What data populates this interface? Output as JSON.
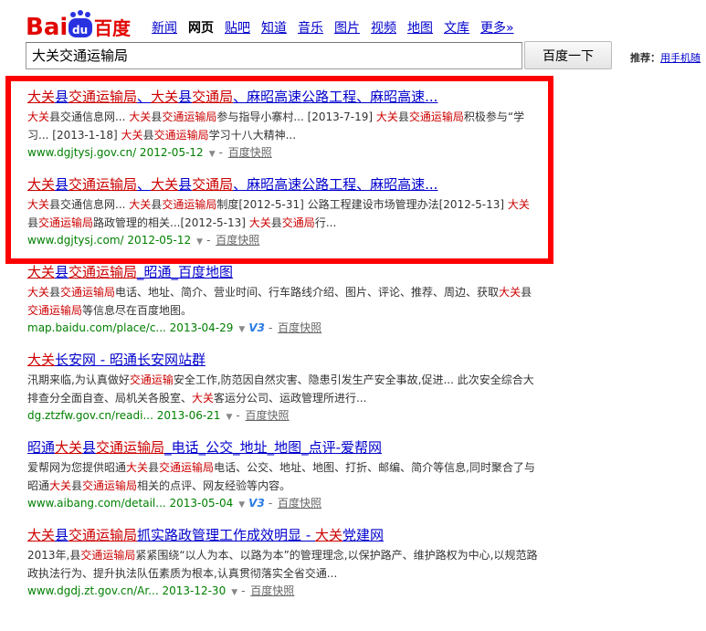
{
  "logo": {
    "text_bai": "Bai",
    "text_du": "du",
    "text_cn": "百度"
  },
  "nav": [
    "新闻",
    "网页",
    "贴吧",
    "知道",
    "音乐",
    "图片",
    "视频",
    "地图",
    "文库",
    "更多»"
  ],
  "nav_active": 1,
  "search": {
    "query": "大关交通运输局",
    "button": "百度一下"
  },
  "recommend": {
    "label": "推荐：",
    "link": "用手机随"
  },
  "results": [
    {
      "title": [
        [
          "大关",
          "h"
        ],
        [
          "县",
          "n"
        ],
        [
          "交通运输局",
          "h"
        ],
        [
          "、",
          "n"
        ],
        [
          "大关",
          "h"
        ],
        [
          "县",
          "n"
        ],
        [
          "交通局",
          "h"
        ],
        [
          "、麻昭高速公路工程、麻昭高速...",
          "n"
        ]
      ],
      "abstract": [
        [
          "大关",
          "h"
        ],
        [
          "县交通信息网... ",
          "n"
        ],
        [
          "大关",
          "h"
        ],
        [
          "县",
          "n"
        ],
        [
          "交通运输局",
          "h"
        ],
        [
          "参与指导小寨村... [2013-7-19] ",
          "n"
        ],
        [
          "大关",
          "h"
        ],
        [
          "县",
          "n"
        ],
        [
          "交通运输局",
          "h"
        ],
        [
          "积极参与“学习... [2013-1-18] ",
          "n"
        ],
        [
          "大关",
          "h"
        ],
        [
          "县",
          "n"
        ],
        [
          "交通运输局",
          "h"
        ],
        [
          "学习十八大精神...",
          "n"
        ]
      ],
      "url": "www.dgjtysj.gov.cn/ 2012-05-12",
      "v3": false,
      "snapshot": "百度快照"
    },
    {
      "title": [
        [
          "大关",
          "h"
        ],
        [
          "县",
          "n"
        ],
        [
          "交通运输局",
          "h"
        ],
        [
          "、",
          "n"
        ],
        [
          "大关",
          "h"
        ],
        [
          "县",
          "n"
        ],
        [
          "交通局",
          "h"
        ],
        [
          "、麻昭高速公路工程、麻昭高速...",
          "n"
        ]
      ],
      "abstract": [
        [
          "大关",
          "h"
        ],
        [
          "县交通信息网... ",
          "n"
        ],
        [
          "大关",
          "h"
        ],
        [
          "县",
          "n"
        ],
        [
          "交通运输局",
          "h"
        ],
        [
          "制度[2012-5-31] 公路工程建设市场管理办法[2012-5-13] ",
          "n"
        ],
        [
          "大关",
          "h"
        ],
        [
          "县",
          "n"
        ],
        [
          "交通运输局",
          "h"
        ],
        [
          "路政管理的相关...[2012-5-13] ",
          "n"
        ],
        [
          "大关",
          "h"
        ],
        [
          "县",
          "n"
        ],
        [
          "交通局",
          "h"
        ],
        [
          "行...",
          "n"
        ]
      ],
      "url": "www.dgjtysj.com/ 2012-05-12",
      "v3": false,
      "snapshot": "百度快照"
    },
    {
      "title": [
        [
          "大关",
          "h"
        ],
        [
          "县",
          "n"
        ],
        [
          "交通运输局",
          "h"
        ],
        [
          "_昭通_百度地图",
          "n"
        ]
      ],
      "abstract": [
        [
          "大关",
          "h"
        ],
        [
          "县",
          "n"
        ],
        [
          "交通运输局",
          "h"
        ],
        [
          "电话、地址、简介、营业时间、行车路线介绍、图片、评论、推荐、周边、获取",
          "n"
        ],
        [
          "大关",
          "h"
        ],
        [
          "县",
          "n"
        ],
        [
          "交通运输局",
          "h"
        ],
        [
          "等信息尽在百度地图。",
          "n"
        ]
      ],
      "url": "map.baidu.com/place/c... 2013-04-29",
      "v3": true,
      "snapshot": "百度快照"
    },
    {
      "title": [
        [
          "大关",
          "h"
        ],
        [
          "长安网 - 昭通长安网站群",
          "n"
        ]
      ],
      "abstract": [
        [
          "汛期来临,为认真做好",
          "n"
        ],
        [
          "交通运输",
          "h"
        ],
        [
          "安全工作,防范因自然灾害、隐患引发生产安全事故,促进... 此次安全综合大排查分全面自查、局机关各股室、",
          "n"
        ],
        [
          "大关",
          "h"
        ],
        [
          "客运分公司、运政管理所进行...",
          "n"
        ]
      ],
      "url": "dg.ztzfw.gov.cn/readi... 2013-06-21",
      "v3": false,
      "snapshot": "百度快照"
    },
    {
      "title": [
        [
          "昭通",
          "n"
        ],
        [
          "大关",
          "h"
        ],
        [
          "县",
          "n"
        ],
        [
          "交通运输局",
          "h"
        ],
        [
          "_电话_公交_地址_地图_点评-爱帮网",
          "n"
        ]
      ],
      "abstract": [
        [
          "爱帮网为您提供昭通",
          "n"
        ],
        [
          "大关",
          "h"
        ],
        [
          "县",
          "n"
        ],
        [
          "交通运输局",
          "h"
        ],
        [
          "电话、公交、地址、地图、打折、邮编、简介等信息,同时聚合了与昭通",
          "n"
        ],
        [
          "大关",
          "h"
        ],
        [
          "县",
          "n"
        ],
        [
          "交通运输局",
          "h"
        ],
        [
          "相关的点评、网友经验等内容。",
          "n"
        ]
      ],
      "url": "www.aibang.com/detail... 2013-05-04",
      "v3": true,
      "snapshot": "百度快照"
    },
    {
      "title": [
        [
          "大关",
          "h"
        ],
        [
          "县",
          "n"
        ],
        [
          "交通运输局",
          "h"
        ],
        [
          "抓实路政管理工作成效明显 - ",
          "n"
        ],
        [
          "大关",
          "h"
        ],
        [
          "党建网",
          "n"
        ]
      ],
      "abstract": [
        [
          "2013年,县",
          "n"
        ],
        [
          "交通运输局",
          "h"
        ],
        [
          "紧紧围绕“以人为本、以路为本”的管理理念,以保护路产、维护路权为中心,以规范路政执法行为、提升执法队伍素质为根本,认真贯彻落实全省交通...",
          "n"
        ]
      ],
      "url": "www.dgdj.zt.gov.cn/Ar... 2013-12-30",
      "v3": false,
      "snapshot": "百度快照"
    }
  ]
}
